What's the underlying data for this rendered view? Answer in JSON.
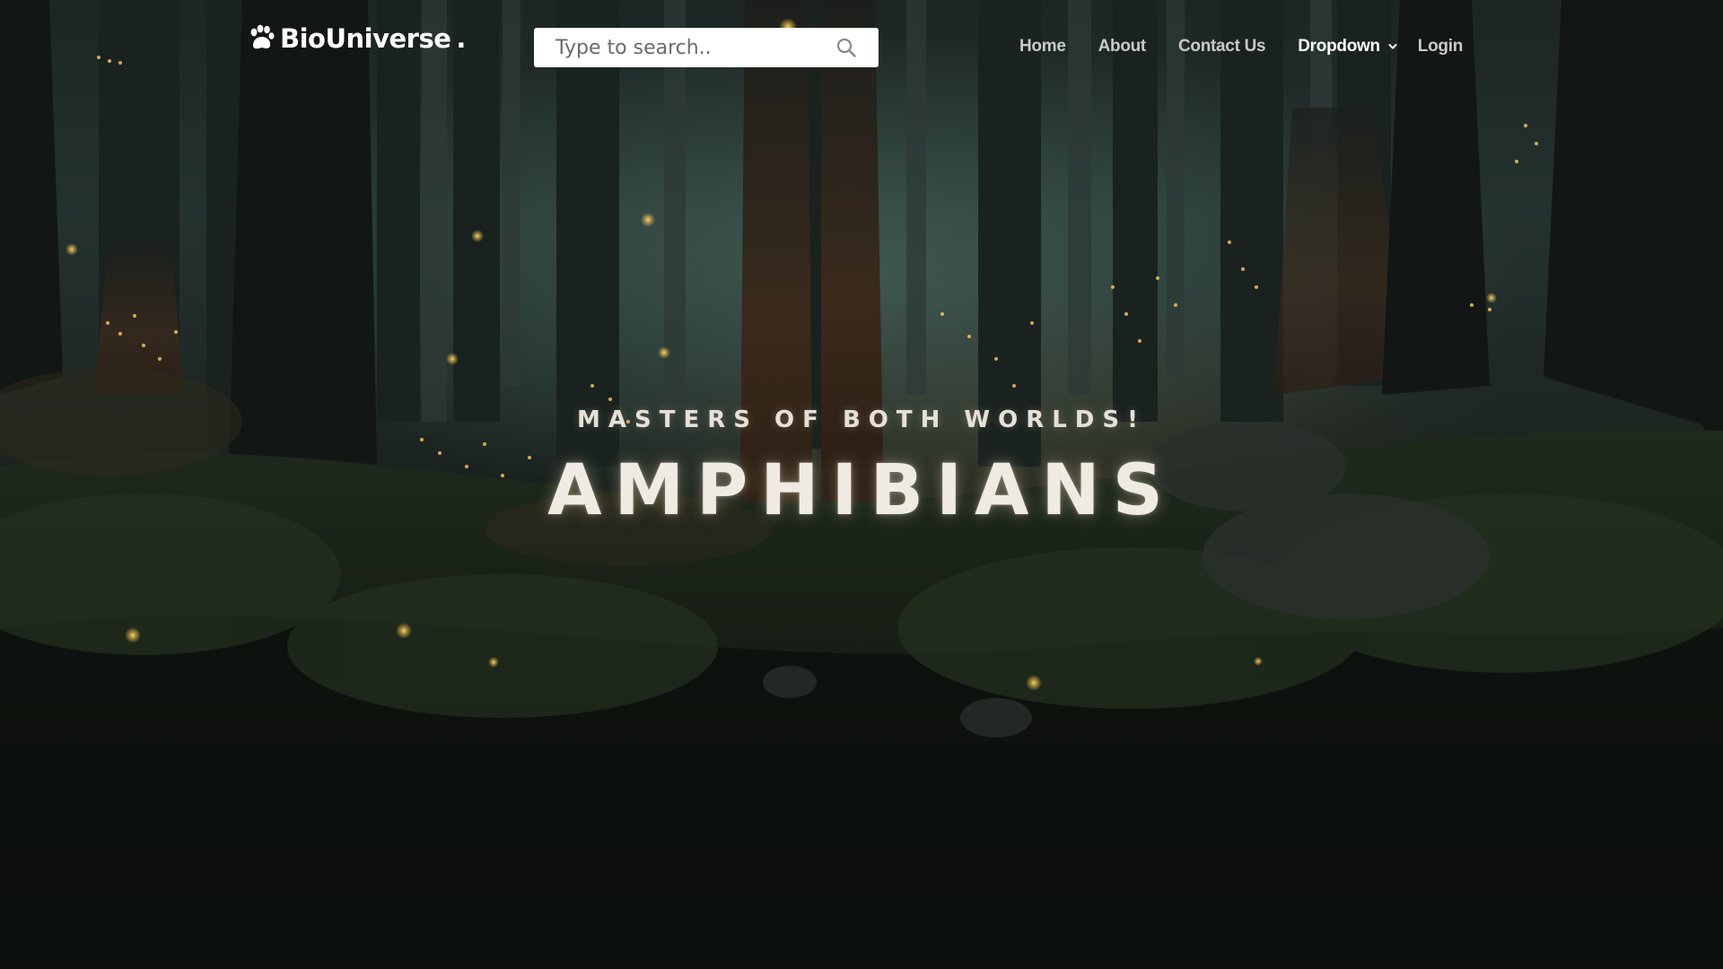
{
  "brand": {
    "name": "BioUniverse",
    "suffix": "."
  },
  "search": {
    "placeholder": "Type to search.."
  },
  "nav": {
    "items": [
      {
        "label": "Home"
      },
      {
        "label": "About"
      },
      {
        "label": "Contact Us"
      },
      {
        "label": "Dropdown"
      },
      {
        "label": "Login"
      }
    ]
  },
  "hero": {
    "subtitle": "MASTERS OF BOTH WORLDS!",
    "title": "AMPHIBIANS"
  },
  "icons": {
    "logo": "paw-icon",
    "search": "search-icon",
    "dropdown": "chevron-down-icon"
  },
  "colors": {
    "nav_text": "#c9c9c9",
    "nav_active": "#ffffff",
    "hero_text": "#efebe3",
    "firefly": "#f5c453"
  }
}
